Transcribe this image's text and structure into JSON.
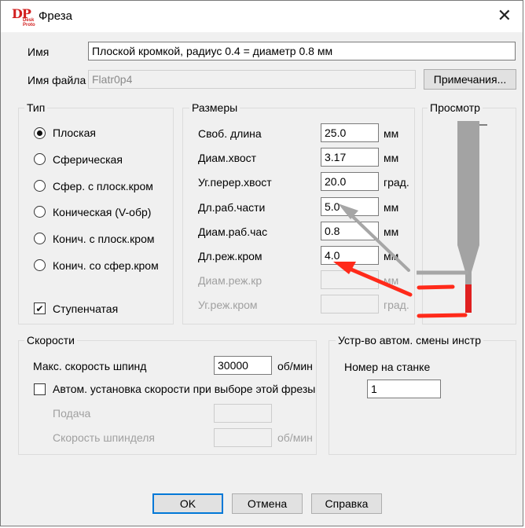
{
  "window": {
    "title": "Фреза",
    "app_icon_text": "DP",
    "app_icon_sub": "Desk Proto"
  },
  "name": {
    "label": "Имя",
    "value": "Плоской кромкой, радиус 0.4 = диаметр 0.8 мм"
  },
  "filename": {
    "label": "Имя файла",
    "value": "Flatr0p4",
    "notes_button": "Примечания..."
  },
  "type_group": {
    "title": "Тип",
    "options": [
      {
        "label": "Плоская",
        "selected": true
      },
      {
        "label": "Сферическая",
        "selected": false
      },
      {
        "label": "Сфер. с плоск.кром",
        "selected": false
      },
      {
        "label": "Коническая (V-обр)",
        "selected": false
      },
      {
        "label": "Конич. с плоск.кром",
        "selected": false
      },
      {
        "label": "Конич. со сфер.кром",
        "selected": false
      }
    ],
    "stepped": {
      "label": "Ступенчатая",
      "checked": true
    }
  },
  "sizes": {
    "title": "Размеры",
    "rows": [
      {
        "label": "Своб. длина",
        "value": "25.0",
        "unit": "мм",
        "enabled": true
      },
      {
        "label": "Диам.хвост",
        "value": "3.17",
        "unit": "мм",
        "enabled": true
      },
      {
        "label": "Уг.перер.хвост",
        "value": "20.0",
        "unit": "град.",
        "enabled": true
      },
      {
        "label": "Дл.раб.части",
        "value": "5.0",
        "unit": "мм",
        "enabled": true
      },
      {
        "label": "Диам.раб.час",
        "value": "0.8",
        "unit": "мм",
        "enabled": true
      },
      {
        "label": "Дл.реж.кром",
        "value": "4.0",
        "unit": "мм",
        "enabled": true
      },
      {
        "label": "Диам.реж.кр",
        "value": "",
        "unit": "мм",
        "enabled": false
      },
      {
        "label": "Уг.реж.кром",
        "value": "",
        "unit": "град.",
        "enabled": false
      }
    ]
  },
  "preview": {
    "title": "Просмотр"
  },
  "speeds": {
    "title": "Скорости",
    "max_spindle": {
      "label": "Макс. скорость шпинд",
      "value": "30000",
      "unit": "об/мин"
    },
    "auto_set": {
      "label": "Автом. установка скорости при выборе этой фрезы",
      "checked": false
    },
    "feed": {
      "label": "Подача",
      "value": ""
    },
    "spindle": {
      "label": "Скорость шпинделя",
      "value": "",
      "unit": "об/мин"
    }
  },
  "toolchanger": {
    "title": "Устр-во автом. смены инстр",
    "number_label": "Номер на станке",
    "number_value": "1"
  },
  "buttons": {
    "ok": "OK",
    "cancel": "Отмена",
    "help": "Справка"
  },
  "colors": {
    "accent": "#0078d7",
    "annotation_red": "#ff2a1a",
    "annotation_gray": "#a6a6a6",
    "tool_gray": "#a3a3a3",
    "tool_red": "#e02020"
  }
}
